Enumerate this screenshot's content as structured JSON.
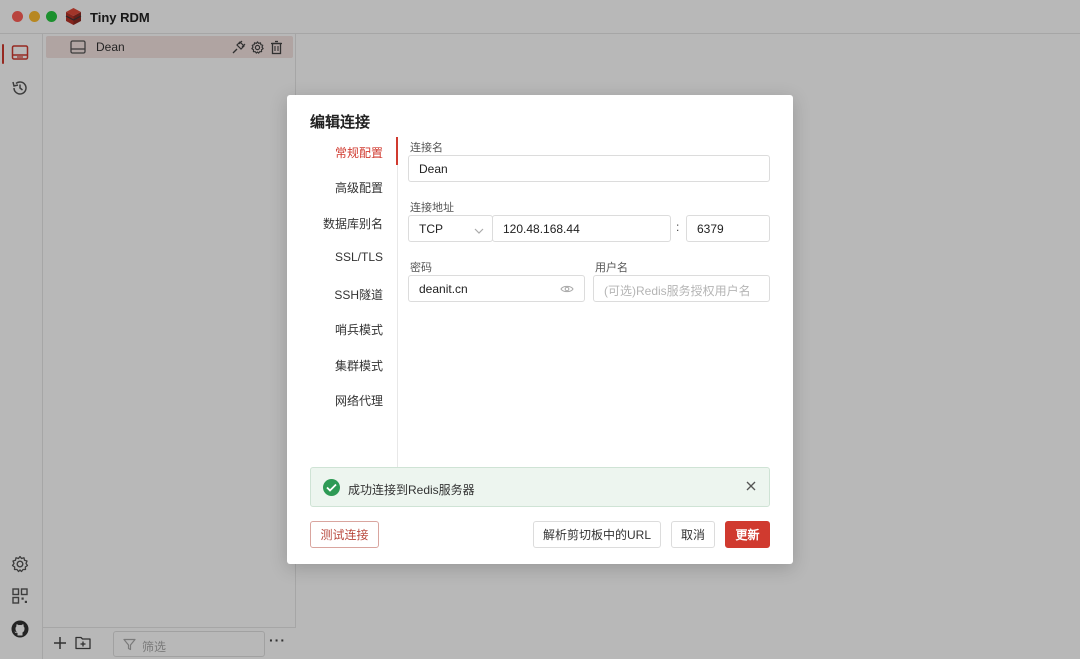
{
  "app": {
    "title": "Tiny RDM"
  },
  "colors": {
    "accent": "#d03a2f",
    "success": "#2e9a55"
  },
  "ribbon": {
    "top_items": [
      {
        "icon": "server-icon",
        "active": true
      },
      {
        "icon": "history-icon",
        "active": false
      }
    ],
    "bottom_items": [
      {
        "icon": "gear-icon"
      },
      {
        "icon": "grid-icon"
      },
      {
        "icon": "github-icon"
      }
    ]
  },
  "sidebar": {
    "connections": [
      {
        "label": "Dean",
        "icon": "server-icon",
        "actions": [
          "connect-icon",
          "gear-icon",
          "trash-icon"
        ]
      }
    ],
    "footer": {
      "filter_placeholder": "筛选",
      "more_label": "···"
    }
  },
  "dialog": {
    "title": "编辑连接",
    "tabs": [
      {
        "label": "常规配置",
        "active": true
      },
      {
        "label": "高级配置",
        "active": false
      },
      {
        "label": "数据库别名",
        "active": false
      },
      {
        "label": "SSL/TLS",
        "active": false
      },
      {
        "label": "SSH隧道",
        "active": false
      },
      {
        "label": "哨兵模式",
        "active": false
      },
      {
        "label": "集群模式",
        "active": false
      },
      {
        "label": "网络代理",
        "active": false
      }
    ],
    "form": {
      "name_label": "连接名",
      "name_value": "Dean",
      "address_label": "连接地址",
      "protocol_value": "TCP",
      "host_value": "120.48.168.44",
      "port_separator": ":",
      "port_value": "6379",
      "password_label": "密码",
      "password_value": "deanit.cn",
      "username_label": "用户名",
      "username_placeholder": "(可选)Redis服务授权用户名"
    },
    "alert": {
      "type": "success",
      "message": "成功连接到Redis服务器"
    },
    "buttons": {
      "test": "测试连接",
      "parse_url": "解析剪切板中的URL",
      "cancel": "取消",
      "update": "更新"
    }
  }
}
